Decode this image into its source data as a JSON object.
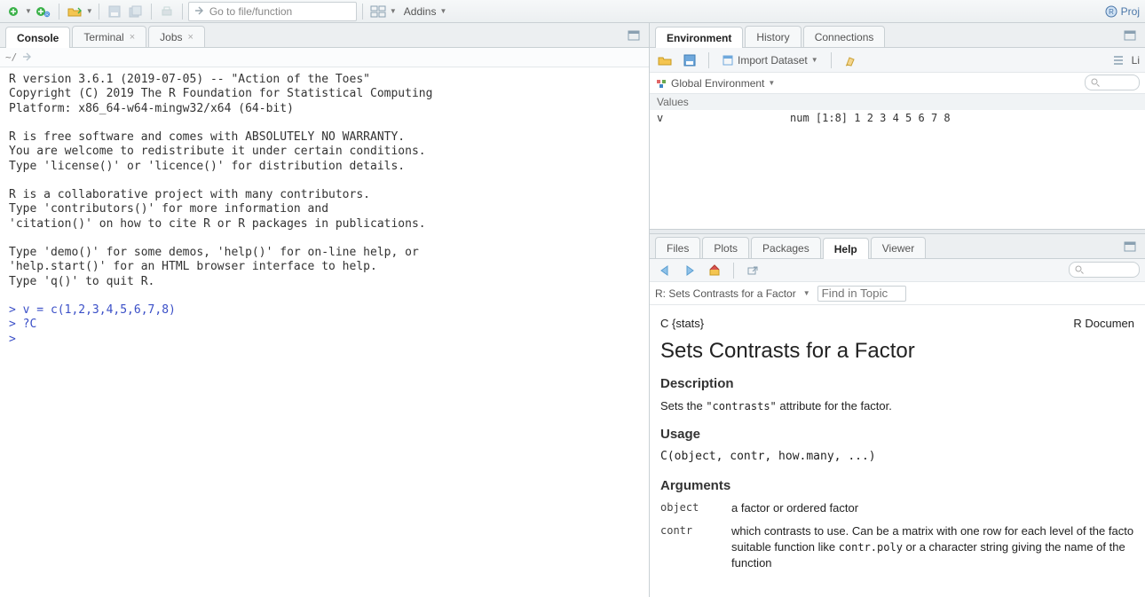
{
  "toolbar": {
    "goto_placeholder": "Go to file/function",
    "addins_label": "Addins",
    "project_label": "Proj"
  },
  "left": {
    "tabs": [
      {
        "label": "Console",
        "closable": false,
        "active": true
      },
      {
        "label": "Terminal",
        "closable": true,
        "active": false
      },
      {
        "label": "Jobs",
        "closable": true,
        "active": false
      }
    ],
    "path_label": "~/",
    "console_text": "R version 3.6.1 (2019-07-05) -- \"Action of the Toes\"\nCopyright (C) 2019 The R Foundation for Statistical Computing\nPlatform: x86_64-w64-mingw32/x64 (64-bit)\n\nR is free software and comes with ABSOLUTELY NO WARRANTY.\nYou are welcome to redistribute it under certain conditions.\nType 'license()' or 'licence()' for distribution details.\n\nR is a collaborative project with many contributors.\nType 'contributors()' for more information and\n'citation()' on how to cite R or R packages in publications.\n\nType 'demo()' for some demos, 'help()' for on-line help, or\n'help.start()' for an HTML browser interface to help.\nType 'q()' to quit R.\n",
    "console_lines": [
      "v = c(1,2,3,4,5,6,7,8)",
      "?C",
      ""
    ],
    "prompt": ">"
  },
  "env": {
    "tabs": [
      {
        "label": "Environment",
        "active": true
      },
      {
        "label": "History",
        "active": false
      },
      {
        "label": "Connections",
        "active": false
      }
    ],
    "import_label": "Import Dataset",
    "list_label": "Li",
    "scope_label": "Global Environment",
    "section_label": "Values",
    "rows": [
      {
        "name": "v",
        "value": "num [1:8] 1 2 3 4 5 6 7 8"
      }
    ]
  },
  "help": {
    "tabs": [
      {
        "label": "Files",
        "active": false
      },
      {
        "label": "Plots",
        "active": false
      },
      {
        "label": "Packages",
        "active": false
      },
      {
        "label": "Help",
        "active": true
      },
      {
        "label": "Viewer",
        "active": false
      }
    ],
    "breadcrumb": "R: Sets Contrasts for a Factor",
    "find_placeholder": "Find in Topic",
    "doc_left": "C {stats}",
    "doc_right": "R Documen",
    "title": "Sets Contrasts for a Factor",
    "desc_heading": "Description",
    "desc_text_pre": "Sets the ",
    "desc_code": "\"contrasts\"",
    "desc_text_post": " attribute for the factor.",
    "usage_heading": "Usage",
    "usage_code": "C(object, contr, how.many, ...)",
    "args_heading": "Arguments",
    "args": [
      {
        "name": "object",
        "desc": "a factor or ordered factor"
      },
      {
        "name": "contr",
        "desc_pre": "which contrasts to use. Can be a matrix with one row for each level of the facto suitable function like ",
        "code": "contr.poly",
        "desc_post": " or a character string giving the name of the function"
      }
    ]
  }
}
